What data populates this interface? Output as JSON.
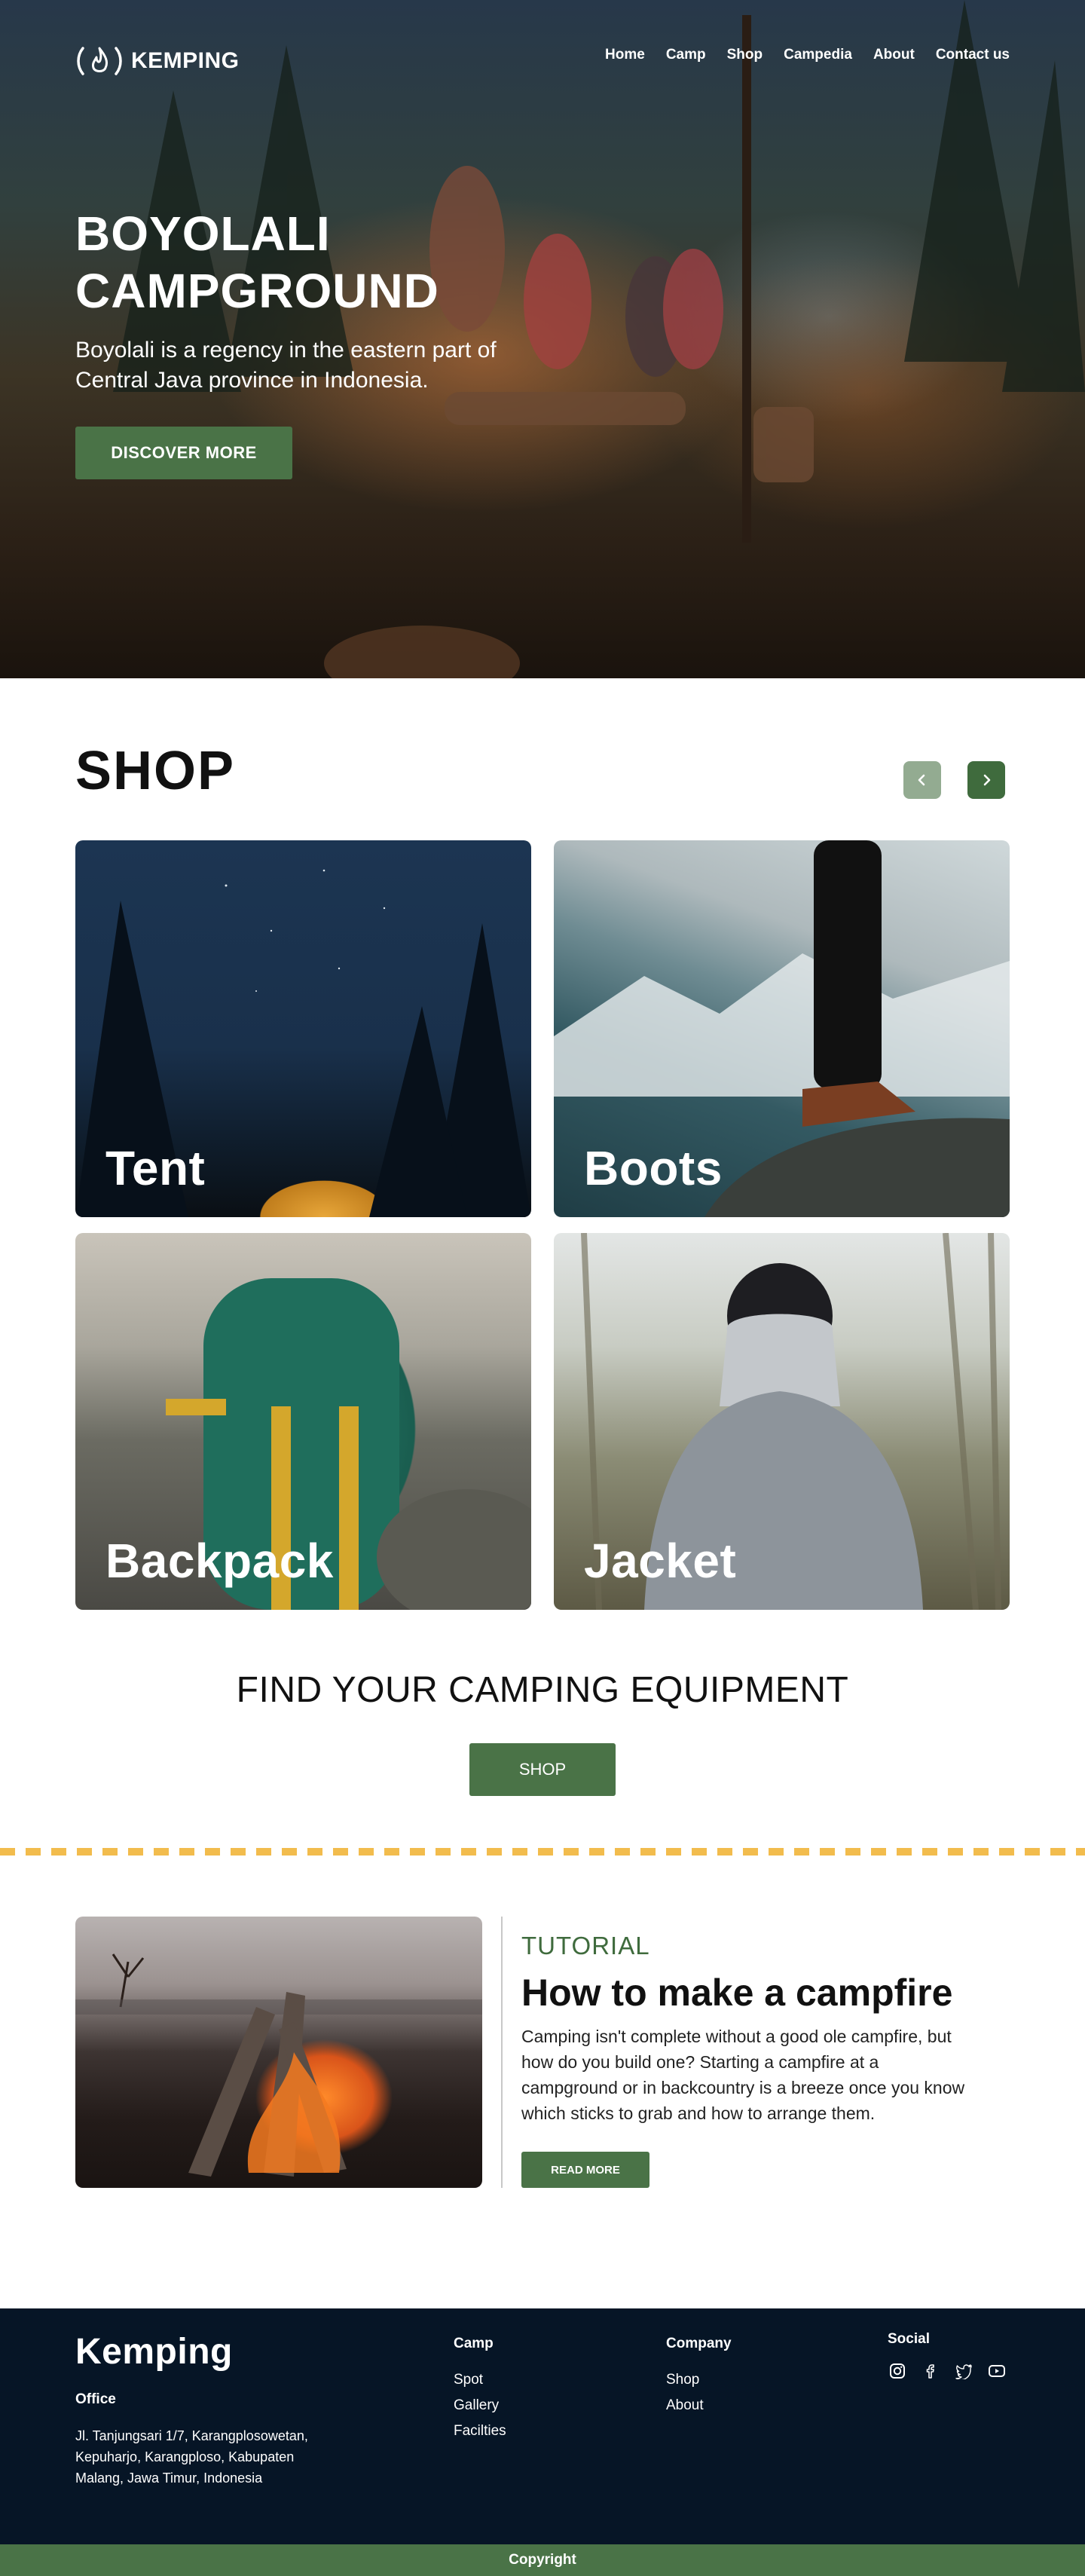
{
  "nav": {
    "logo_text": "KEMPING",
    "links": [
      "Home",
      "Camp",
      "Shop",
      "Campedia",
      "About",
      "Contact us"
    ]
  },
  "hero": {
    "title": "BOYOLALI CAMPGROUND",
    "subtitle": "Boyolali is a regency in the eastern part of Central Java province in Indonesia.",
    "button": "DISCOVER MORE"
  },
  "shop": {
    "title": "SHOP",
    "prev_icon": "chevron-left-icon",
    "next_icon": "chevron-right-icon",
    "cards": [
      "Tent",
      "Boots",
      "Backpack",
      "Jacket"
    ],
    "cta_title": "FIND YOUR CAMPING EQUIPMENT",
    "cta_button": "SHOP"
  },
  "tutorial": {
    "label": "TUTORIAL",
    "title": "How to make a campfire",
    "body": "Camping isn't complete without a good ole campfire, but how do you build one? Starting a campfire at a campground or in backcountry is a breeze once you know which sticks to grab and how to arrange them.",
    "button": "READ MORE"
  },
  "footer": {
    "brand": "Kemping",
    "office_label": "Office",
    "address": "Jl. Tanjungsari 1/7, Karangplosowetan, Kepuharjo, Karangploso, Kabupaten Malang, Jawa Timur, Indonesia",
    "camp": {
      "title": "Camp",
      "links": [
        "Spot",
        "Gallery",
        "Facilties"
      ]
    },
    "company": {
      "title": "Company",
      "links": [
        "Shop",
        "About"
      ]
    },
    "social": {
      "title": "Social",
      "icons": [
        "instagram-icon",
        "facebook-icon",
        "twitter-icon",
        "youtube-icon"
      ]
    },
    "copyright": "Copyright"
  },
  "colors": {
    "accent_green": "#4a7347",
    "footer_bg": "#061526",
    "divider_yellow": "#f2bc4d"
  }
}
